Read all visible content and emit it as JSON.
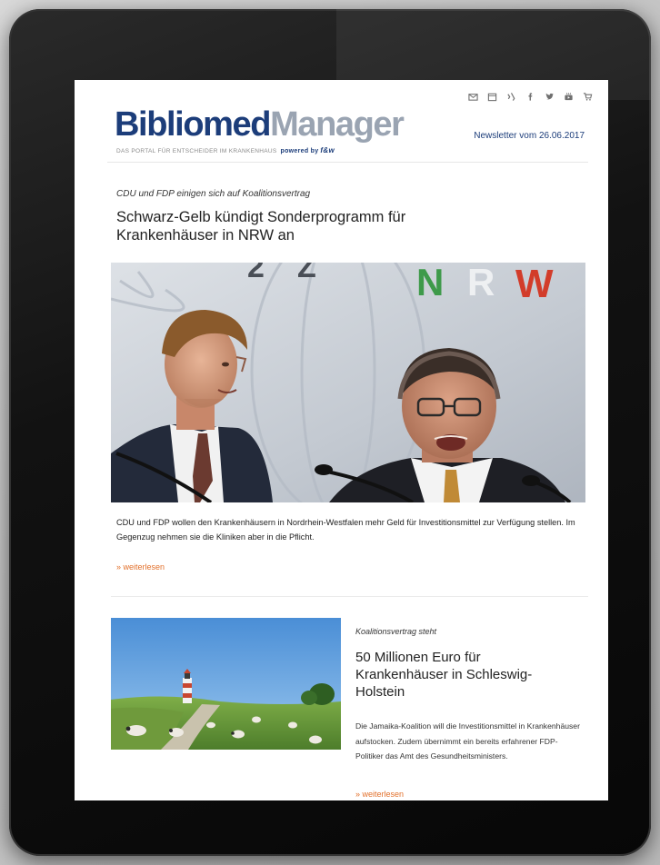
{
  "header": {
    "logo_part1": "Bibliomed",
    "logo_part2": "Manager",
    "tagline": "DAS PORTAL FÜR ENTSCHEIDER IM KRANKENHAUS",
    "powered_by": "powered by",
    "powered_logo": "f&w",
    "newsletter_date": "Newsletter vom 26.06.2017"
  },
  "social_icons": [
    "mail-icon",
    "calendar-icon",
    "xing-icon",
    "facebook-icon",
    "twitter-icon",
    "youtube-icon",
    "cart-icon"
  ],
  "lead_article": {
    "kicker": "CDU und FDP einigen sich auf Koalitionsvertrag",
    "headline": "Schwarz-Gelb kündigt Sonderprogramm für Krankenhäuser in NRW an",
    "teaser": "CDU und FDP wollen den Krankenhäusern in Nordrhein-Westfalen mehr Geld für Investitionsmittel zur Verfügung stellen. Im Gegenzug nehmen sie die Kliniken aber in die Pflicht.",
    "more_link": "» weiterlesen",
    "backdrop_letters": [
      "N",
      "R",
      "W"
    ]
  },
  "second_article": {
    "kicker": "Koalitionsvertrag steht",
    "headline": "50 Millionen Euro für Krankenhäuser in Schleswig-Holstein",
    "teaser": "Die Jamaika-Koalition will die Investitionsmittel in Krankenhäuser aufstocken. Zudem übernimmt ein bereits erfahrener FDP-Politiker das Amt des Gesundheitsministers.",
    "more_link": "» weiterlesen"
  },
  "colors": {
    "brand_blue": "#1c3d7a",
    "brand_grey": "#9aa4b2",
    "link_orange": "#e2702b",
    "tablet_black": "#0c0c0c"
  }
}
